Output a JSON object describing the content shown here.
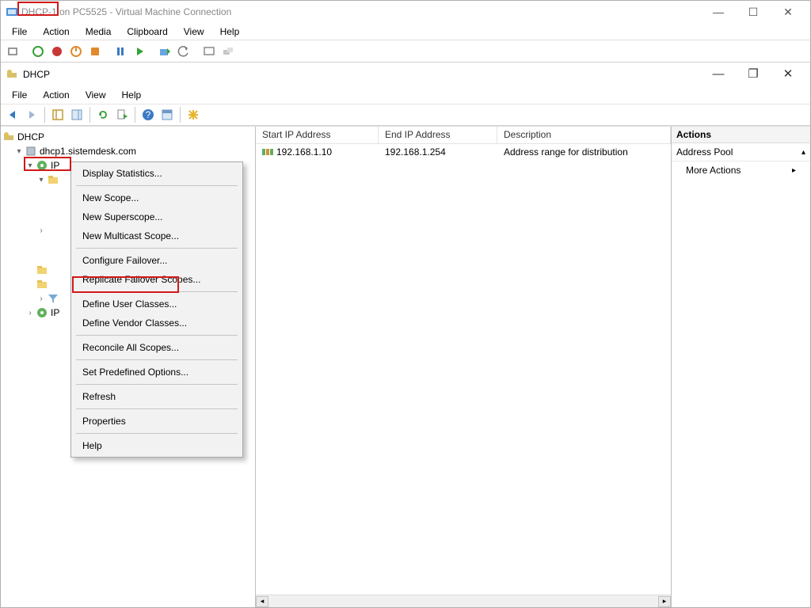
{
  "vm": {
    "title": "DHCP-1 on PC5525 - Virtual Machine Connection",
    "menubar": [
      "File",
      "Action",
      "Media",
      "Clipboard",
      "View",
      "Help"
    ]
  },
  "inner": {
    "title": "DHCP",
    "menubar": [
      "File",
      "Action",
      "View",
      "Help"
    ]
  },
  "tree": {
    "root": "DHCP",
    "server": "dhcp1.sistemdesk.com",
    "ipv4": "IPv4",
    "ipv6": "IPv6",
    "ipshort": "IP"
  },
  "table": {
    "headers": {
      "start": "Start IP Address",
      "end": "End IP Address",
      "desc": "Description"
    },
    "row": {
      "start": "192.168.1.10",
      "end": "192.168.1.254",
      "desc": "Address range for distribution"
    }
  },
  "actions": {
    "title": "Actions",
    "section": "Address Pool",
    "more": "More Actions"
  },
  "context_menu": {
    "items": [
      "Display Statistics...",
      "New Scope...",
      "New Superscope...",
      "New Multicast Scope...",
      "Configure Failover...",
      "Replicate Failover Scopes...",
      "Define User Classes...",
      "Define Vendor Classes...",
      "Reconcile All Scopes...",
      "Set Predefined Options...",
      "Refresh",
      "Properties",
      "Help"
    ]
  }
}
